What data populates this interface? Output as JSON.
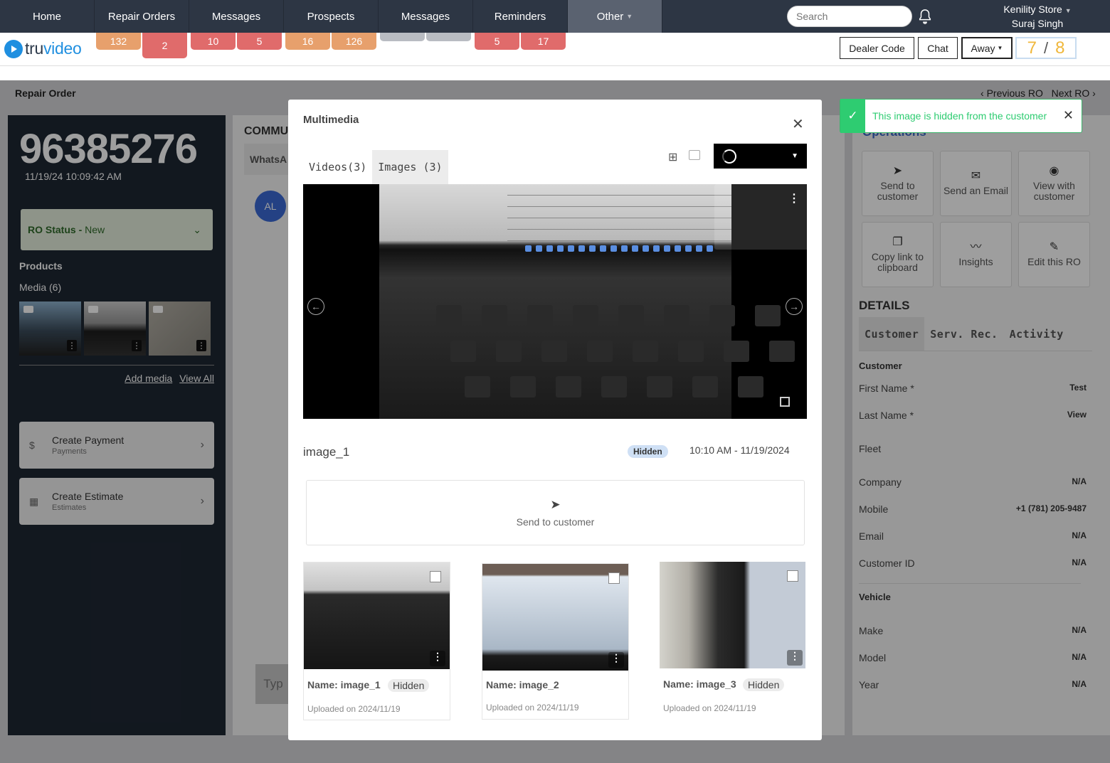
{
  "nav": {
    "tabs": [
      "Home",
      "Repair Orders",
      "Messages",
      "Prospects",
      "Messages",
      "Reminders",
      "Other"
    ],
    "search_placeholder": "Search",
    "store_name": "Kenility Store",
    "user_name": "Suraj Singh"
  },
  "badges": [
    {
      "label": "132",
      "color": "#e7a06c"
    },
    {
      "label": "2",
      "color": "#e06b6b"
    },
    {
      "label": "10",
      "color": "#e06b6b"
    },
    {
      "label": "5",
      "color": "#e06b6b"
    },
    {
      "label": "16",
      "color": "#e7a06c"
    },
    {
      "label": "126",
      "color": "#e7a06c"
    },
    {
      "label": "",
      "color": "#b9bcc2"
    },
    {
      "label": "",
      "color": "#b9bcc2"
    },
    {
      "label": "5",
      "color": "#e06b6b"
    },
    {
      "label": "17",
      "color": "#e06b6b"
    }
  ],
  "header": {
    "logo_text_1": "tru",
    "logo_text_2": "video",
    "dealer_code": "Dealer Code",
    "chat": "Chat",
    "away": "Away",
    "counter_a": "7",
    "counter_sep": "/",
    "counter_b": "8"
  },
  "page": {
    "breadcrumb": "Repair Order",
    "previous": "Previous RO",
    "next": "Next RO"
  },
  "left": {
    "ro_number": "96385276",
    "ro_date": "11/19/24 10:09:42 AM",
    "ro_status_label": "RO Status -",
    "ro_status_value": "New",
    "products": "Products",
    "media": "Media (6)",
    "add_media": "Add media",
    "view_all": "View All",
    "create_payment": "Create Payment",
    "payments": "Payments",
    "create_estimate": "Create Estimate",
    "estimates": "Estimates"
  },
  "middle": {
    "heading": "COMMU",
    "whatsapp_tab": "WhatsA",
    "avatar": "AL",
    "type_placeholder": "Typ"
  },
  "right": {
    "ops_title": "Operations",
    "ops": [
      "Send to customer",
      "Send an Email",
      "View with customer",
      "Copy link to clipboard",
      "Insights",
      "Edit this RO"
    ],
    "details": "DETAILS",
    "tabs": [
      "Customer",
      "Serv. Rec.",
      "Activity"
    ],
    "customer_group": "Customer",
    "fields": [
      {
        "label": "First Name *",
        "value": "Test"
      },
      {
        "label": "Last Name *",
        "value": "View"
      },
      {
        "label": "Fleet",
        "value": ""
      },
      {
        "label": "Company",
        "value": "N/A"
      },
      {
        "label": "Mobile",
        "value": "+1 (781) 205-9487"
      },
      {
        "label": "Email",
        "value": "N/A"
      },
      {
        "label": "Customer ID",
        "value": "N/A"
      }
    ],
    "vehicle_group": "Vehicle",
    "vehicle_fields": [
      {
        "label": "Make",
        "value": "N/A"
      },
      {
        "label": "Model",
        "value": "N/A"
      },
      {
        "label": "Year",
        "value": "N/A"
      }
    ]
  },
  "modal": {
    "title": "Multimedia",
    "tab_videos": "Videos(3)",
    "tab_images": "Images (3)",
    "image_name": "image_1",
    "hidden_badge": "Hidden",
    "image_time": "10:10 AM - 11/19/2024",
    "send_to_customer": "Send to customer",
    "cards": [
      {
        "name": "Name: image_1",
        "hidden": "Hidden",
        "uploaded": "Uploaded on 2024/11/19"
      },
      {
        "name": "Name: image_2",
        "hidden": "",
        "uploaded": "Uploaded on 2024/11/19"
      },
      {
        "name": "Name: image_3",
        "hidden": "Hidden",
        "uploaded": "Uploaded on 2024/11/19"
      }
    ]
  },
  "toast": {
    "message": "This image is hidden from the customer",
    "color": "#2ecc71"
  }
}
